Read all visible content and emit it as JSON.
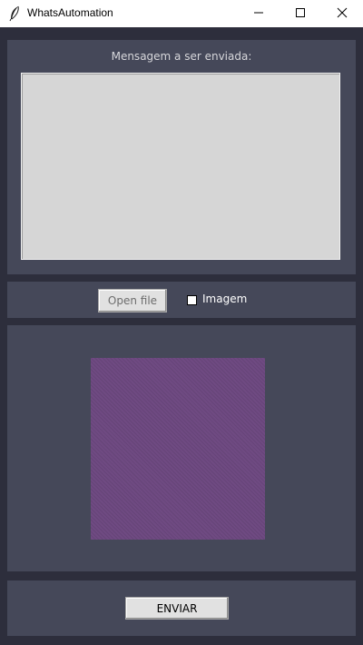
{
  "window": {
    "title": "WhatsAutomation",
    "icon": "feather-icon",
    "controls": [
      "minimize-icon",
      "maximize-icon",
      "close-icon"
    ]
  },
  "message_panel": {
    "label": "Mensagem a ser enviada:",
    "value": ""
  },
  "file_panel": {
    "open_file_label": "Open file",
    "checkbox_label": "Imagem",
    "checkbox_checked": false
  },
  "image_panel": {
    "preview_color": "#6f4a82"
  },
  "send_panel": {
    "send_label": "ENVIAR"
  },
  "colors": {
    "background": "#2d2e3c",
    "panel": "#454859",
    "text_light": "#d7d7db"
  }
}
